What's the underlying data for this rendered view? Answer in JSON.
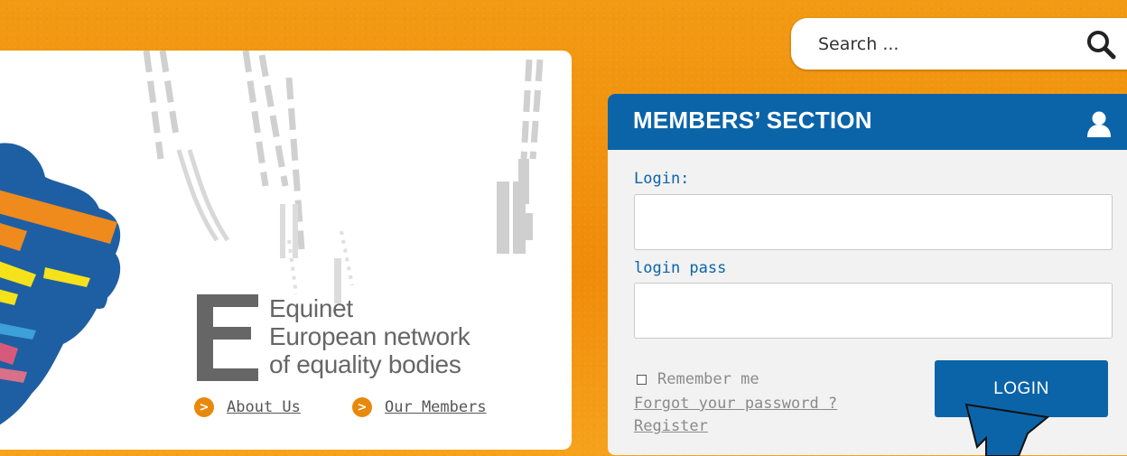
{
  "search": {
    "placeholder": "Search ..."
  },
  "banner": {
    "logo_lines": [
      "Equinet",
      "European network",
      "of equality bodies"
    ],
    "links": [
      {
        "label": "About Us"
      },
      {
        "label": "Our Members"
      }
    ],
    "bullet_glyph": ">"
  },
  "members": {
    "title": "MEMBERS’ SECTION",
    "login_label": "Login:",
    "password_label": "login pass",
    "remember_label": "Remember me",
    "forgot_link": "Forgot your password ?",
    "register_link": "Register",
    "login_button": "LOGIN"
  },
  "colors": {
    "accent_blue": "#0b64a8",
    "orange": "#f08c0a",
    "logo_gray": "#666666"
  },
  "icons": {
    "search": "search-icon",
    "user": "user-icon"
  }
}
